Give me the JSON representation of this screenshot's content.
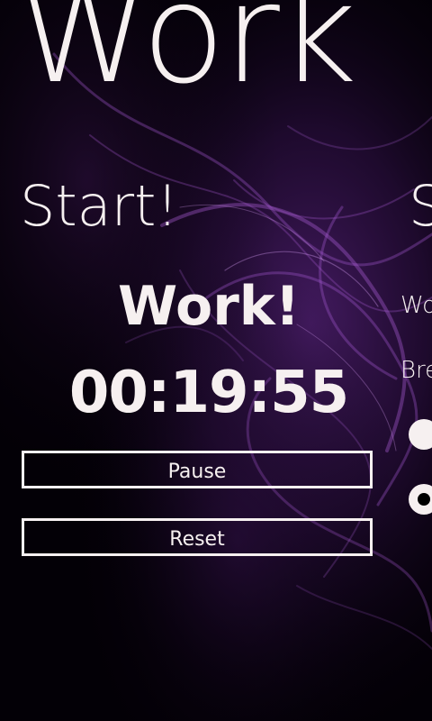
{
  "app": {
    "title": "Work"
  },
  "panorama": {
    "current_header": "Start!",
    "next_header": "S"
  },
  "timer": {
    "mode_label": "Work!",
    "time": "00:19:55"
  },
  "controls": {
    "pause_label": "Pause",
    "reset_label": "Reset"
  },
  "settings_peek": {
    "work_label": "Wo",
    "break_label": "Bre"
  },
  "colors": {
    "foreground": "#f6f0f0",
    "background": "#030006",
    "accent_purple": "#8a3fb8"
  }
}
